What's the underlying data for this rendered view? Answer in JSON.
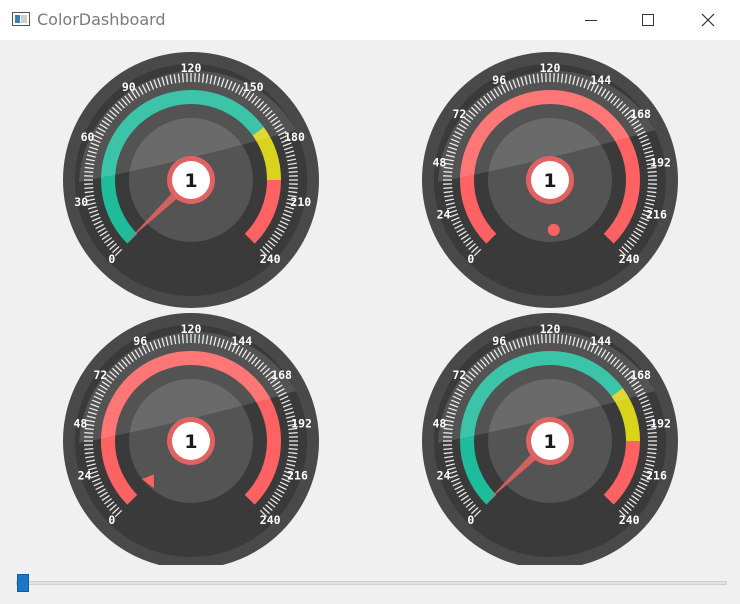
{
  "window": {
    "title": "ColorDashboard"
  },
  "colors": {
    "outer_ring": "#494949",
    "face": "#3a3a3a",
    "inner": "#545454",
    "tick": "#e8e8e8",
    "label": "#ffffff",
    "teal": "#1fbc9c",
    "yellow": "#d9d31c",
    "red": "#ff6262",
    "hub_ring": "#e06262",
    "hub": "#ffffff",
    "hub_text": "#1a1a1a",
    "window_bg": "#f0f0f0"
  },
  "gauges": [
    {
      "style": "sections",
      "min": 0,
      "max": 240,
      "value": 1,
      "value_label": "1",
      "tick_labels": [
        "0",
        "30",
        "60",
        "90",
        "120",
        "150",
        "180",
        "210",
        "240"
      ],
      "sections": [
        {
          "from": 0,
          "to": 168,
          "color": "teal"
        },
        {
          "from": 168,
          "to": 200,
          "color": "yellow"
        },
        {
          "from": 200,
          "to": 240,
          "color": "red"
        }
      ],
      "pointer": "needle"
    },
    {
      "style": "progress-ring",
      "min": 0,
      "max": 240,
      "value": 1,
      "value_label": "1",
      "tick_labels": [
        "0",
        "24",
        "48",
        "72",
        "96",
        "120",
        "144",
        "168",
        "192",
        "216",
        "240"
      ],
      "ring_color": "red",
      "pointer": "dot"
    },
    {
      "style": "progress-ring",
      "min": 0,
      "max": 240,
      "value": 1,
      "value_label": "1",
      "tick_labels": [
        "0",
        "24",
        "48",
        "72",
        "96",
        "120",
        "144",
        "168",
        "192",
        "216",
        "240"
      ],
      "ring_color": "red",
      "pointer": "triangle"
    },
    {
      "style": "sections",
      "min": 0,
      "max": 240,
      "value": 1,
      "value_label": "1",
      "tick_labels": [
        "0",
        "24",
        "48",
        "72",
        "96",
        "120",
        "144",
        "168",
        "192",
        "216",
        "240"
      ],
      "sections": [
        {
          "from": 0,
          "to": 168,
          "color": "teal"
        },
        {
          "from": 168,
          "to": 200,
          "color": "yellow"
        },
        {
          "from": 200,
          "to": 240,
          "color": "red"
        }
      ],
      "pointer": "needle"
    }
  ],
  "slider": {
    "value": 1,
    "min": 0,
    "max": 240
  }
}
